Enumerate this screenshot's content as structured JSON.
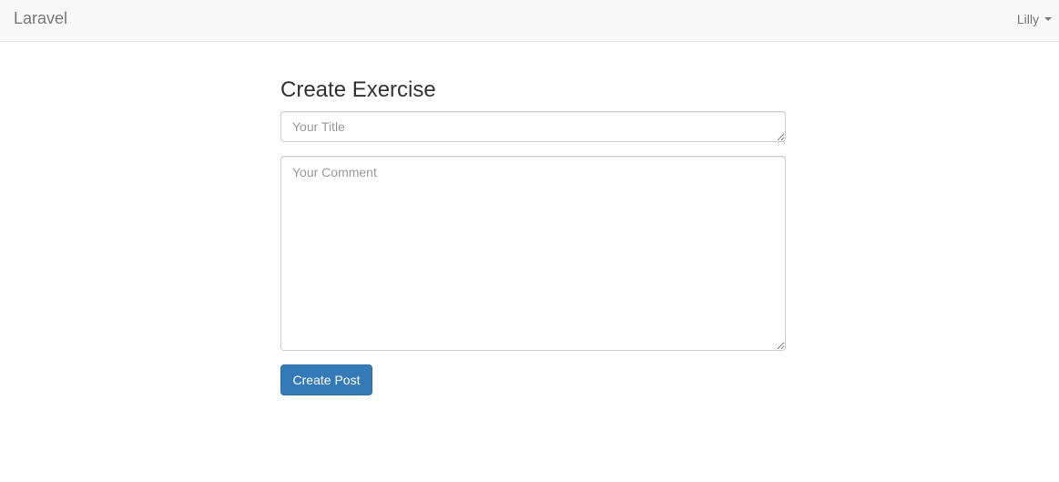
{
  "navbar": {
    "brand": "Laravel",
    "user_name": "Lilly",
    "user_menu_icon": "caret-down-icon"
  },
  "form": {
    "title": "Create Exercise",
    "title_placeholder": "Your Title",
    "title_value": "",
    "comment_placeholder": "Your Comment",
    "comment_value": "",
    "submit_label": "Create Post"
  },
  "colors": {
    "navbar_bg": "#f8f8f8",
    "primary": "#337ab7",
    "muted_text": "#777777"
  }
}
